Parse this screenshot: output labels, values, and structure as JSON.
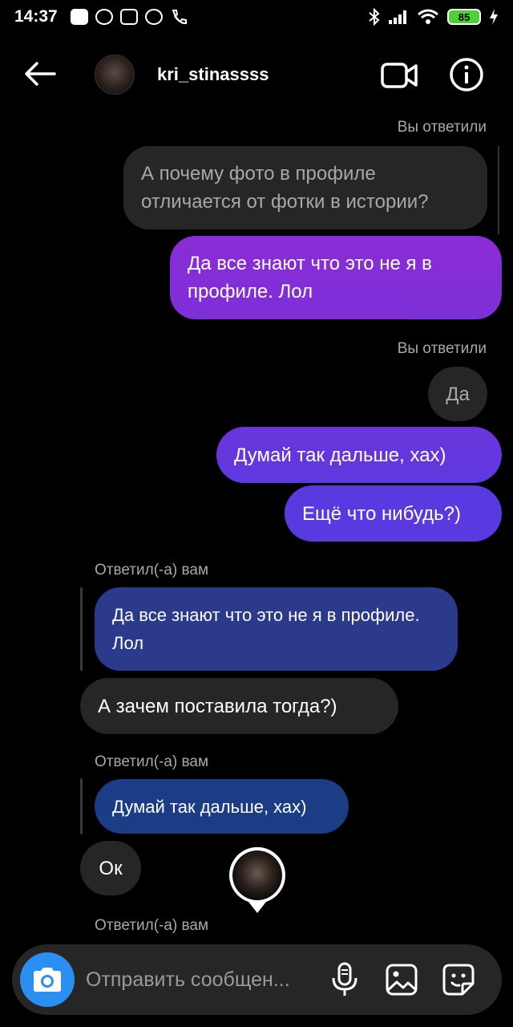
{
  "status_bar": {
    "time": "14:37",
    "battery": "85",
    "notification_icons": [
      "youtube-icon",
      "mail-icon",
      "instagram-icon",
      "viber-icon",
      "call-icon"
    ],
    "system_icons": [
      "bluetooth-icon",
      "signal-icon",
      "wifi-icon",
      "battery-icon",
      "charging-icon"
    ]
  },
  "header": {
    "username": "kri_stinassss",
    "icons": [
      "back-arrow-icon",
      "video-call-icon",
      "info-icon"
    ]
  },
  "messages": [
    {
      "type": "meta",
      "text": "Вы ответили"
    },
    {
      "type": "quoted",
      "text": "А почему фото в профиле отличается от фотки в истории?"
    },
    {
      "type": "outgoing",
      "text": "Да все знают что это не я в профиле. Лол"
    },
    {
      "type": "meta",
      "text": "Вы ответили"
    },
    {
      "type": "quoted",
      "text": "Да"
    },
    {
      "type": "outgoing",
      "text": "Думай так дальше, хах)"
    },
    {
      "type": "outgoing",
      "text": "Ещё что нибудь?)"
    },
    {
      "type": "meta",
      "text": "Ответил(-а) вам"
    },
    {
      "type": "reply-quote",
      "text": "Да все знают что это не я в профиле. Лол"
    },
    {
      "type": "incoming",
      "text": "А зачем поставила тогда?)"
    },
    {
      "type": "meta",
      "text": "Ответил(-а) вам"
    },
    {
      "type": "reply-quote",
      "text": "Думай так дальше, хах)"
    },
    {
      "type": "incoming",
      "text": "Ок"
    },
    {
      "type": "meta",
      "text": "Ответил(-а) вам"
    }
  ],
  "composer": {
    "placeholder": "Отправить сообщен...",
    "icons": [
      "camera-icon",
      "microphone-icon",
      "gallery-icon",
      "sticker-icon"
    ]
  },
  "colors": {
    "background": "#000000",
    "bubble_gray": "#262626",
    "gradient_purple": "#8a2cd6",
    "gradient_violet": "#5a3ae0",
    "reply_blue": "#2b3a8a",
    "reply_navy": "#1a3d86",
    "camera_blue": "#2b8ff2"
  }
}
